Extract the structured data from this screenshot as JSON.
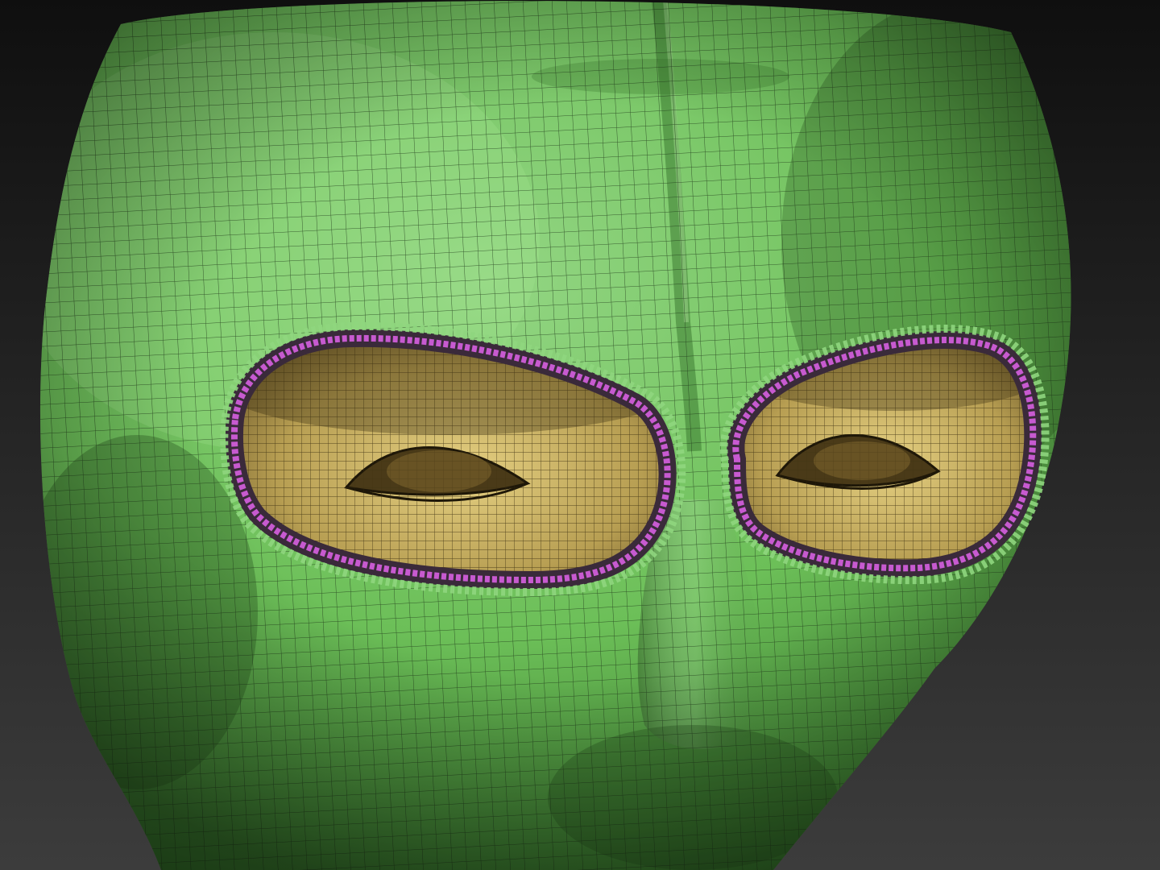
{
  "scene": {
    "subject": "wireframe-mesh-balaclava-head",
    "colors": {
      "background_top": "#0f0f0f",
      "background_bottom": "#3c3c3c",
      "mask_light": "#93d683",
      "mask_mid": "#6cbf58",
      "mask_dark": "#2f6a25",
      "mesh_line": "#1d3518",
      "skin_light": "#e6d183",
      "skin_mid": "#b79e52",
      "skin_dark": "#5a4820",
      "rim_magenta": "#c75ad0",
      "rim_dark": "#3a2a3a"
    },
    "icons": [
      "head-mesh",
      "eye-opening-left",
      "eye-opening-right"
    ]
  }
}
